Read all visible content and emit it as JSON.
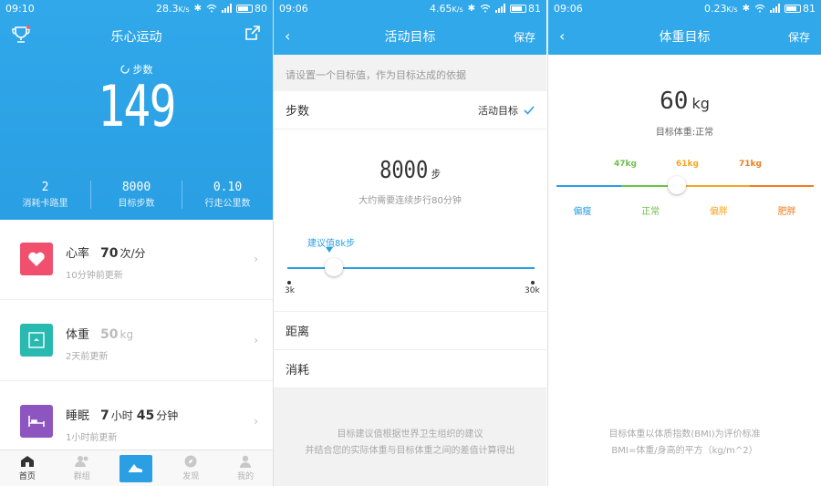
{
  "panel1": {
    "status": {
      "time": "09:10",
      "speed": "28.3",
      "speed_unit": "K/s",
      "battery": "80"
    },
    "app_title": "乐心运动",
    "steps_label": "步数",
    "steps_value": "149",
    "stats": [
      {
        "value": "2",
        "label": "消耗卡路里"
      },
      {
        "value": "8000",
        "label": "目标步数"
      },
      {
        "value": "0.10",
        "label": "行走公里数"
      }
    ],
    "cards": [
      {
        "title": "心率",
        "value": "70",
        "unit": "次/分",
        "sub": "10分钟前更新",
        "color": "#f0506e"
      },
      {
        "title": "体重",
        "value": "50",
        "unit": "kg",
        "sub": "2天前更新",
        "color": "#28b9b0"
      },
      {
        "title": "睡眠",
        "value": "7",
        "unit": "小时",
        "value2": "45",
        "unit2": "分钟",
        "sub": "1小时前更新",
        "color": "#8d55c0"
      }
    ],
    "nav": [
      {
        "label": "首页",
        "icon": "home-icon",
        "active": true
      },
      {
        "label": "群组",
        "icon": "group-icon",
        "active": false
      },
      {
        "label": "",
        "icon": "shoe-icon",
        "active": false
      },
      {
        "label": "发现",
        "icon": "compass-icon",
        "active": false
      },
      {
        "label": "我的",
        "icon": "user-icon",
        "active": false
      }
    ]
  },
  "panel2": {
    "status": {
      "time": "09:06",
      "speed": "4.65",
      "speed_unit": "K/s",
      "battery": "81"
    },
    "title": "活动目标",
    "save": "保存",
    "hint": "请设置一个目标值，作为目标达成的依据",
    "steps_row_label": "步数",
    "steps_row_value": "活动目标",
    "goal_value": "8000",
    "goal_unit": "步",
    "goal_sub": "大约需要连续步行80分钟",
    "slider_tip": "建议值8k步",
    "slider_min": "3k",
    "slider_max": "30k",
    "slider_fraction": 0.19,
    "distance_label": "距离",
    "consume_label": "消耗",
    "footer_line1": "目标建议值根据世界卫生组织的建议",
    "footer_line2": "并结合您的实际体重与目标体重之间的差值计算得出"
  },
  "panel3": {
    "status": {
      "time": "09:06",
      "speed": "0.23",
      "speed_unit": "K/s",
      "battery": "81"
    },
    "title": "体重目标",
    "save": "保存",
    "weight_value": "60",
    "weight_unit": "kg",
    "weight_status": "目标体重:正常",
    "thresholds": [
      "47kg",
      "61kg",
      "71kg"
    ],
    "categories": [
      {
        "label": "偏瘦",
        "color": "#2a9fe3"
      },
      {
        "label": "正常",
        "color": "#6cc24a"
      },
      {
        "label": "偏胖",
        "color": "#f5a623"
      },
      {
        "label": "肥胖",
        "color": "#f07c22"
      }
    ],
    "footer_line1": "目标体重以体质指数(BMI)为评价标准",
    "footer_line2": "BMI=体重/身高的平方（kg/m^2）"
  }
}
